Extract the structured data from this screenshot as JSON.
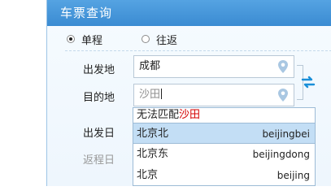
{
  "panel": {
    "title": "车票查询"
  },
  "trip_type": {
    "options": [
      {
        "label": "单程",
        "checked": true
      },
      {
        "label": "往返",
        "checked": false
      }
    ]
  },
  "form": {
    "from_label": "出发地",
    "from_value": "成都",
    "to_label": "目的地",
    "to_value": "沙田",
    "depart_label": "出发日",
    "return_label": "返程日"
  },
  "icons": {
    "location": "location-pin-icon",
    "swap": "swap-arrows-icon"
  },
  "dropdown": {
    "message_prefix": "无法匹配",
    "message_highlight": "沙田",
    "items": [
      {
        "name": "北京北",
        "pinyin": "beijingbei",
        "selected": true
      },
      {
        "name": "北京东",
        "pinyin": "beijingdong",
        "selected": false
      },
      {
        "name": "北京",
        "pinyin": "beijing",
        "selected": false
      }
    ]
  },
  "colors": {
    "header": "#3a8bd2",
    "highlight": "#d40000",
    "selected_row": "#c3def5",
    "swap_icon": "#1a8fd8"
  }
}
